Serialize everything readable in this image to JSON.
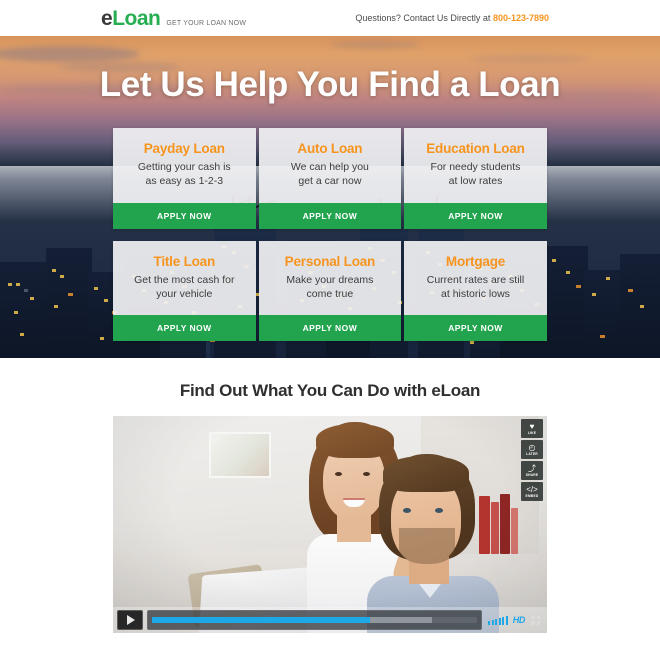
{
  "header": {
    "logo_primary": "e",
    "logo_secondary": "Loan",
    "logo_tagline": "GET YOUR LOAN NOW",
    "contact_text": "Questions? Contact Us Directly at",
    "contact_phone": "800-123-7890"
  },
  "hero": {
    "headline": "Let Us Help You Find a Loan",
    "cards": [
      {
        "title": "Payday Loan",
        "desc_line1": "Getting your cash is",
        "desc_line2": "as easy as 1-2-3",
        "cta": "APPLY NOW"
      },
      {
        "title": "Auto Loan",
        "desc_line1": "We can help you",
        "desc_line2": "get a car now",
        "cta": "APPLY NOW"
      },
      {
        "title": "Education Loan",
        "desc_line1": "For needy students",
        "desc_line2": "at low rates",
        "cta": "APPLY NOW"
      },
      {
        "title": "Title Loan",
        "desc_line1": "Get the most cash for",
        "desc_line2": "your vehicle",
        "cta": "APPLY NOW"
      },
      {
        "title": "Personal Loan",
        "desc_line1": "Make your dreams",
        "desc_line2": "come true",
        "cta": "APPLY NOW"
      },
      {
        "title": "Mortgage",
        "desc_line1": "Current rates are still",
        "desc_line2": "at historic lows",
        "cta": "APPLY NOW"
      }
    ]
  },
  "middle": {
    "section_title": "Find Out What You Can Do with eLoan"
  },
  "video": {
    "rail": [
      {
        "icon": "heart-icon",
        "glyph": "♥",
        "label": "LIKE"
      },
      {
        "icon": "clock-icon",
        "glyph": "◴",
        "label": "LATER"
      },
      {
        "icon": "share-icon",
        "glyph": "⤴",
        "label": "SHARE"
      },
      {
        "icon": "embed-icon",
        "glyph": "</>",
        "label": "EMBED"
      }
    ],
    "controls": {
      "play_glyph": "▶",
      "progress_percent": 67,
      "buffered_percent": 86,
      "quality_label": "HD",
      "volume_bars": 6,
      "fullscreen_icon": "fullscreen-icon"
    }
  },
  "colors": {
    "brand_green": "#22a44e",
    "accent_orange": "#f7941e",
    "logo_dark": "#3a3a3a",
    "player_blue": "#1fa8e8",
    "heading_dark": "#2f2f2f"
  }
}
